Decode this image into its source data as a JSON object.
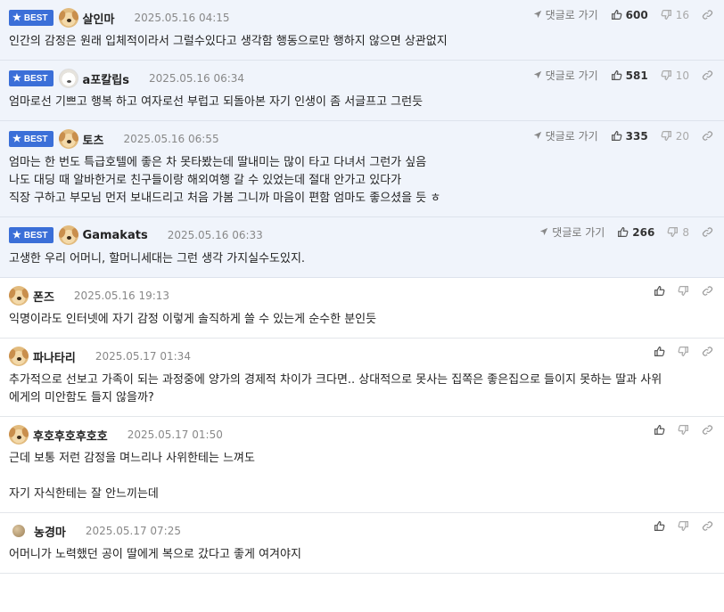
{
  "labels": {
    "best_badge": "BEST",
    "reply_link": "댓글로 가기"
  },
  "colors": {
    "best_bg": "#f0f4fb",
    "badge": "#3b6fd8"
  },
  "comments": [
    {
      "best": true,
      "avatar": "dog",
      "nick": "살인마",
      "time": "2025.05.16 04:15",
      "up": "600",
      "down": "16",
      "lines": [
        "인간의 감정은 원래 입체적이라서 그럴수있다고 생각함 행동으로만 행하지 않으면 상관없지"
      ]
    },
    {
      "best": true,
      "avatar": "white",
      "nick": "a포칼립s",
      "time": "2025.05.16 06:34",
      "up": "581",
      "down": "10",
      "lines": [
        "엄마로선 기쁘고 행복 하고 여자로선 부럽고 되돌아본 자기 인생이 좀 서글프고 그런듯"
      ]
    },
    {
      "best": true,
      "avatar": "dog",
      "nick": "토츠",
      "time": "2025.05.16 06:55",
      "up": "335",
      "down": "20",
      "lines": [
        "엄마는 한 번도 특급호텔에 좋은 차 못타봤는데 딸내미는 많이 타고 다녀서 그런가 싶음",
        "나도 대딩 때 알바한거로 친구들이랑 해외여행 갈 수 있었는데 절대 안가고 있다가",
        "직장 구하고 부모님 먼저 보내드리고 처음 가봄 그니까 마음이 편함 엄마도 좋으셨을 듯 ㅎ"
      ]
    },
    {
      "best": true,
      "avatar": "dog",
      "nick": "Gamakats",
      "time": "2025.05.16 06:33",
      "up": "266",
      "down": "8",
      "lines": [
        "고생한 우리 어머니, 할머니세대는 그런 생각 가지실수도있지."
      ]
    },
    {
      "best": false,
      "avatar": "dog",
      "nick": "폰즈",
      "time": "2025.05.16 19:13",
      "lines": [
        "익명이라도 인터넷에 자기 감정 이렇게 솔직하게 쓸 수 있는게 순수한 분인듯"
      ]
    },
    {
      "best": false,
      "avatar": "dog",
      "nick": "파나타리",
      "time": "2025.05.17 01:34",
      "lines": [
        "추가적으로 선보고 가족이 되는 과정중에 양가의 경제적 차이가 크다면.. 상대적으로 못사는 집쪽은 좋은집으로 들이지 못하는 딸과 사위",
        "에게의 미안함도 들지 않을까?"
      ]
    },
    {
      "best": false,
      "avatar": "dog",
      "nick": "후호후호후호호",
      "time": "2025.05.17 01:50",
      "lines": [
        "근데 보통 저런 감정을 며느리나 사위한테는 느껴도",
        "",
        "자기 자식한테는 잘 안느끼는데"
      ]
    },
    {
      "best": false,
      "avatar": "ball",
      "nick": "농경마",
      "time": "2025.05.17 07:25",
      "lines": [
        "어머니가 노력했던 공이 딸에게 복으로 갔다고 좋게 여겨야지"
      ]
    }
  ]
}
